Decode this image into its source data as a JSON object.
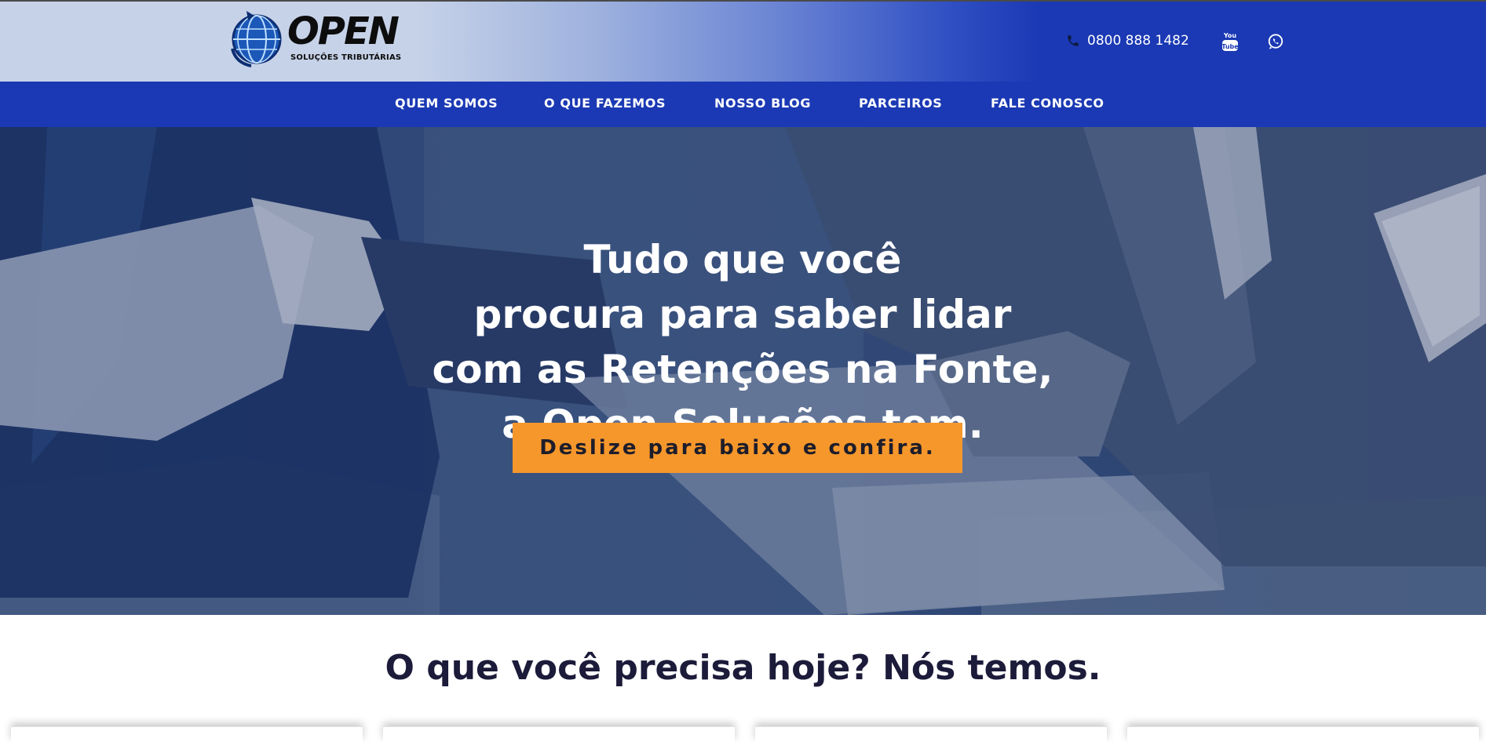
{
  "brand": {
    "logo_word": "OPEN",
    "logo_tagline": "SOLUÇÕES TRIBUTÁRIAS",
    "logo_icon": "globe-icon"
  },
  "header": {
    "phone": "0800 888 1482",
    "phone_icon": "phone-icon",
    "social": [
      "youtube-icon",
      "whatsapp-icon"
    ]
  },
  "nav": {
    "items": [
      {
        "label": "QUEM SOMOS"
      },
      {
        "label": "O QUE FAZEMOS"
      },
      {
        "label": "NOSSO BLOG"
      },
      {
        "label": "PARCEIROS"
      },
      {
        "label": "FALE CONOSCO"
      }
    ]
  },
  "hero": {
    "title_lines": [
      "Tudo que você",
      "procura para saber lidar",
      "com as Retenções na Fonte,",
      "a Open Soluções tem."
    ],
    "cta_label": "Deslize para baixo e confira."
  },
  "section": {
    "heading_regular": "O que você precisa hoje?",
    "heading_bold": "Nós temos."
  },
  "colors": {
    "nav_blue": "#1b39b4",
    "cta_orange": "#f6972b",
    "heading_dark": "#1c1b3a"
  }
}
